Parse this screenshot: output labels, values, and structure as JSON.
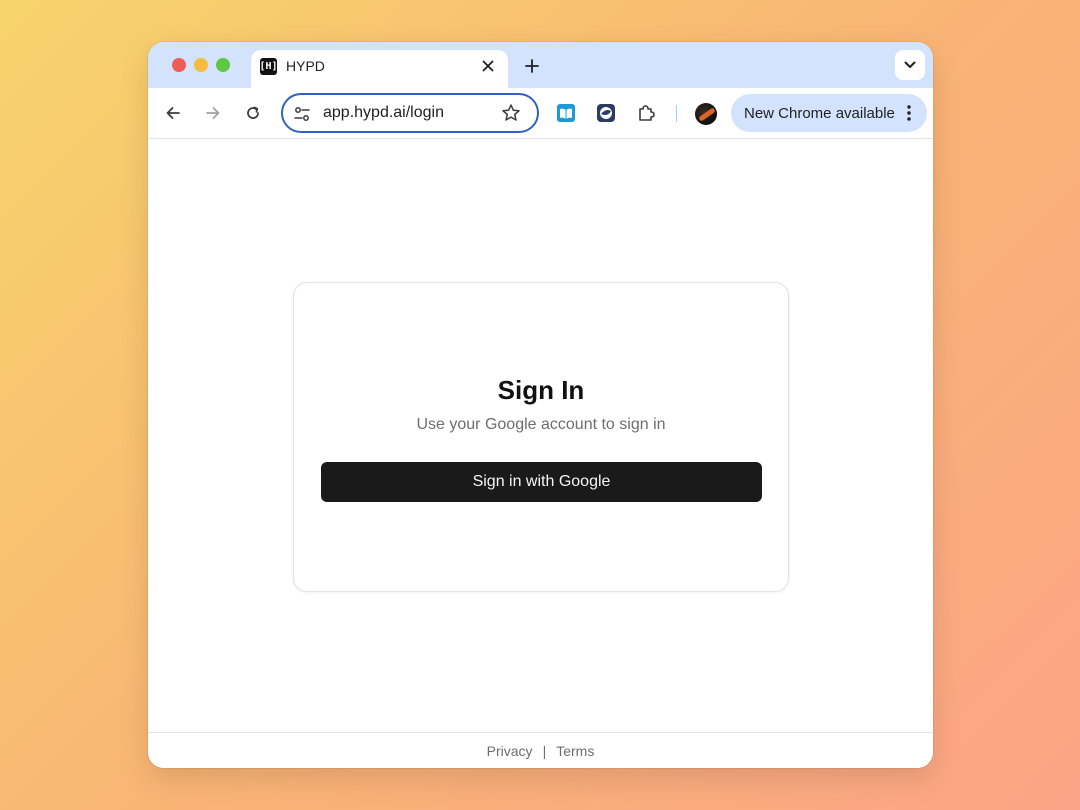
{
  "browser": {
    "tab": {
      "title": "HYPD",
      "favicon_text": "[H]"
    },
    "omnibox": {
      "url": "app.hypd.ai/login"
    },
    "update_pill": {
      "label": "New Chrome available"
    }
  },
  "page": {
    "card": {
      "title": "Sign In",
      "subtitle": "Use your Google account to sign in",
      "button_label": "Sign in with Google"
    },
    "footer": {
      "privacy": "Privacy",
      "separator": "|",
      "terms": "Terms"
    }
  },
  "icons": {
    "back": "arrow-left-icon",
    "forward": "arrow-right-icon",
    "reload": "reload-icon",
    "site_settings": "tune-icon",
    "bookmark": "star-icon",
    "extensions": "puzzle-icon",
    "menu": "kebab-menu-icon"
  },
  "colors": {
    "tab_strip": "#d3e3fd",
    "omnibox_focus": "#2f62c4",
    "button_bg": "#1a1a1a",
    "button_text": "#f5f5f5",
    "traffic_red": "#ee5c56",
    "traffic_yellow": "#f5bd3f",
    "traffic_green": "#5dc842"
  }
}
